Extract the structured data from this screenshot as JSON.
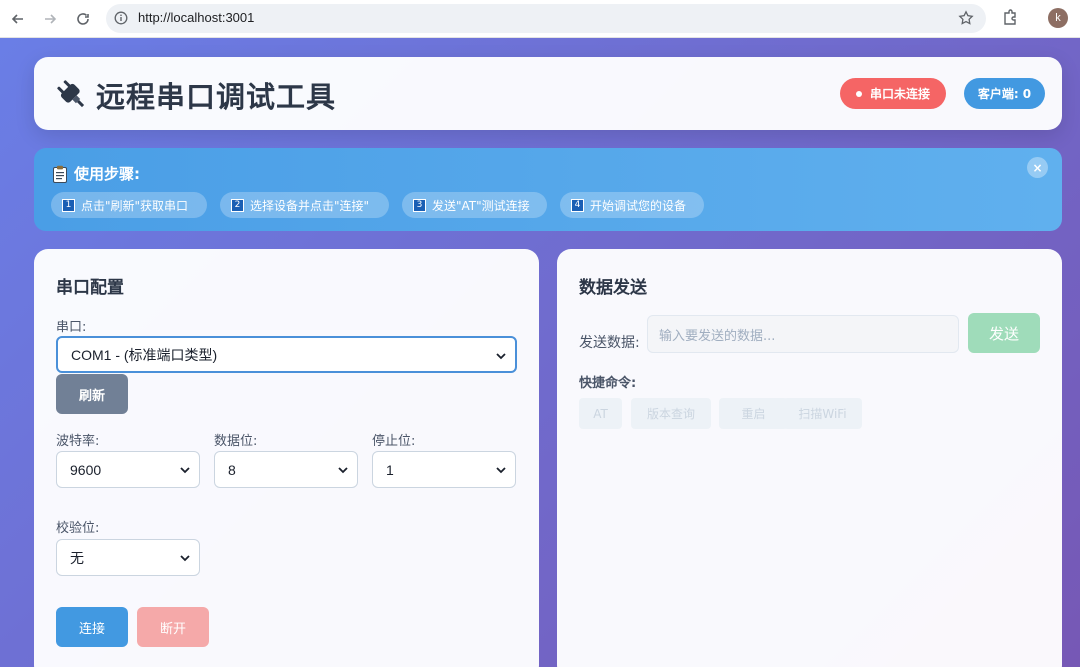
{
  "browser": {
    "url": "http://localhost:3001",
    "profile_initial": "k"
  },
  "header": {
    "title": "远程串口调试工具",
    "status_badge": "串口未连接",
    "clients_badge": "客户端: 0",
    "colors": {
      "status": "#f56565",
      "clients": "#4299e1"
    }
  },
  "guide": {
    "title": "使用步骤:",
    "close": "×",
    "steps": [
      {
        "num": "1",
        "text": "点击\"刷新\"获取串口"
      },
      {
        "num": "2",
        "text": "选择设备并点击\"连接\""
      },
      {
        "num": "3",
        "text": "发送\"AT\"测试连接"
      },
      {
        "num": "4",
        "text": "开始调试您的设备"
      }
    ]
  },
  "serial_config": {
    "title": "串口配置",
    "port_label": "串口:",
    "port_value": "COM1 - (标准端口类型)",
    "refresh_label": "刷新",
    "baud_label": "波特率:",
    "baud_value": "9600",
    "databits_label": "数据位:",
    "databits_value": "8",
    "stopbits_label": "停止位:",
    "stopbits_value": "1",
    "parity_label": "校验位:",
    "parity_value": "无",
    "connect_label": "连接",
    "disconnect_label": "断开"
  },
  "data_send": {
    "title": "数据发送",
    "send_label": "发送数据:",
    "placeholder": "输入要发送的数据...",
    "send_button": "发送",
    "quick_title": "快捷命令:",
    "quick_commands": [
      "AT",
      "版本查询",
      "重启",
      "扫描WiFi"
    ]
  }
}
